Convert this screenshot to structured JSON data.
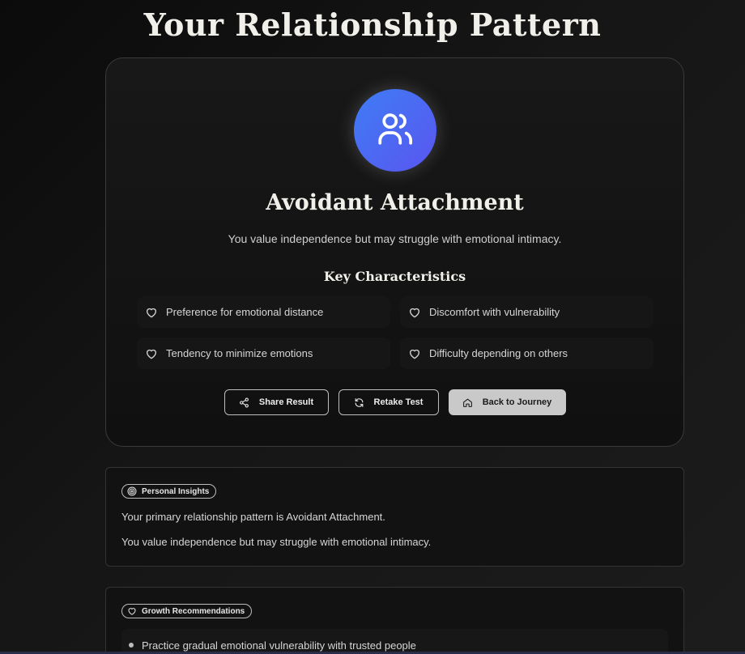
{
  "header": {
    "title": "Your Relationship Pattern"
  },
  "result": {
    "icon": "users-icon",
    "title": "Avoidant Attachment",
    "description": "You value independence but may struggle with emotional intimacy.",
    "characteristics_heading": "Key Characteristics",
    "characteristics": [
      {
        "icon": "heart-icon",
        "label": "Preference for emotional distance"
      },
      {
        "icon": "heart-icon",
        "label": "Discomfort with vulnerability"
      },
      {
        "icon": "heart-icon",
        "label": "Tendency to minimize emotions"
      },
      {
        "icon": "heart-icon",
        "label": "Difficulty depending on others"
      }
    ]
  },
  "actions": {
    "share_label": "Share Result",
    "retake_label": "Retake Test",
    "back_label": "Back to Journey"
  },
  "insights": {
    "badge": "Personal Insights",
    "badge_icon": "target-icon",
    "lines": [
      "Your primary relationship pattern is Avoidant Attachment.",
      "You value independence but may struggle with emotional intimacy."
    ]
  },
  "growth": {
    "badge": "Growth Recommendations",
    "badge_icon": "heart-icon",
    "items": [
      "Practice gradual emotional vulnerability with trusted people"
    ]
  },
  "colors": {
    "accent_gradient_start": "#3e7df4",
    "accent_gradient_end": "#5a55f0",
    "background": "#111111"
  }
}
